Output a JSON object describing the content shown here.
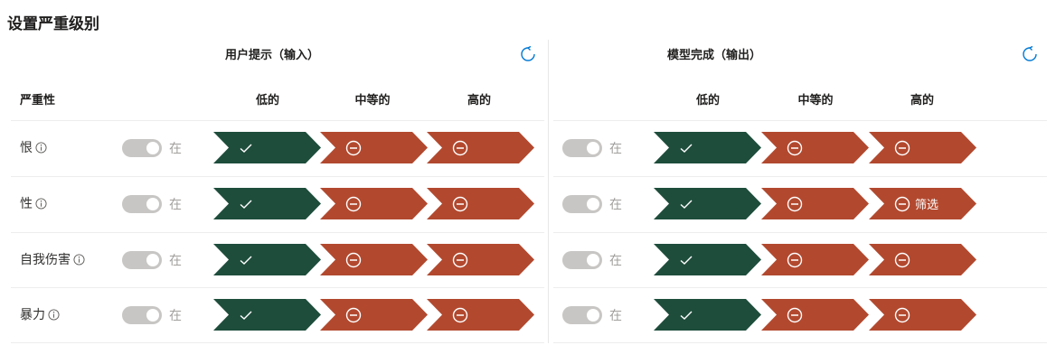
{
  "title": "设置严重级别",
  "input_group": {
    "label": "用户提示（输入）",
    "reset_icon": "refresh-icon"
  },
  "output_group": {
    "label": "模型完成（输出）",
    "reset_icon": "refresh-icon"
  },
  "severity_header": "严重性",
  "levels": [
    "低的",
    "中等的",
    "高的"
  ],
  "toggle_label": "在",
  "colors": {
    "allowed": "#1e4d3c",
    "blocked": "#b2492f",
    "toggle_off": "#c8c6c4"
  },
  "rows": [
    {
      "category": "恨",
      "input": [
        {
          "state": "allowed"
        },
        {
          "state": "blocked"
        },
        {
          "state": "blocked"
        }
      ],
      "output": [
        {
          "state": "allowed"
        },
        {
          "state": "blocked"
        },
        {
          "state": "blocked"
        }
      ]
    },
    {
      "category": "性",
      "input": [
        {
          "state": "allowed"
        },
        {
          "state": "blocked"
        },
        {
          "state": "blocked"
        }
      ],
      "output": [
        {
          "state": "allowed"
        },
        {
          "state": "blocked"
        },
        {
          "state": "blocked",
          "label": "筛选"
        }
      ]
    },
    {
      "category": "自我伤害",
      "input": [
        {
          "state": "allowed"
        },
        {
          "state": "blocked"
        },
        {
          "state": "blocked"
        }
      ],
      "output": [
        {
          "state": "allowed"
        },
        {
          "state": "blocked"
        },
        {
          "state": "blocked"
        }
      ]
    },
    {
      "category": "暴力",
      "input": [
        {
          "state": "allowed"
        },
        {
          "state": "blocked"
        },
        {
          "state": "blocked"
        }
      ],
      "output": [
        {
          "state": "allowed"
        },
        {
          "state": "blocked"
        },
        {
          "state": "blocked"
        }
      ]
    }
  ]
}
